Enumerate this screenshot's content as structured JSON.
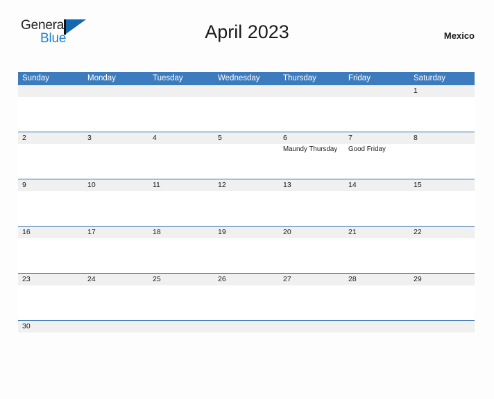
{
  "logo": {
    "word_one": "General",
    "word_two": "Blue",
    "flag_icon": "triangle-flag-icon",
    "primary_color": "#1268b3",
    "text_color": "#231f20"
  },
  "header": {
    "title": "April 2023",
    "region": "Mexico"
  },
  "calendar": {
    "header_bg": "#3c7cbe",
    "rule_color": "#2b6cab",
    "date_band_bg": "#f0f0f0",
    "weekdays": [
      "Sunday",
      "Monday",
      "Tuesday",
      "Wednesday",
      "Thursday",
      "Friday",
      "Saturday"
    ],
    "weeks": [
      {
        "days": [
          {
            "num": "",
            "event": ""
          },
          {
            "num": "",
            "event": ""
          },
          {
            "num": "",
            "event": ""
          },
          {
            "num": "",
            "event": ""
          },
          {
            "num": "",
            "event": ""
          },
          {
            "num": "",
            "event": ""
          },
          {
            "num": "1",
            "event": ""
          }
        ]
      },
      {
        "days": [
          {
            "num": "2",
            "event": ""
          },
          {
            "num": "3",
            "event": ""
          },
          {
            "num": "4",
            "event": ""
          },
          {
            "num": "5",
            "event": ""
          },
          {
            "num": "6",
            "event": "Maundy Thursday"
          },
          {
            "num": "7",
            "event": "Good Friday"
          },
          {
            "num": "8",
            "event": ""
          }
        ]
      },
      {
        "days": [
          {
            "num": "9",
            "event": ""
          },
          {
            "num": "10",
            "event": ""
          },
          {
            "num": "11",
            "event": ""
          },
          {
            "num": "12",
            "event": ""
          },
          {
            "num": "13",
            "event": ""
          },
          {
            "num": "14",
            "event": ""
          },
          {
            "num": "15",
            "event": ""
          }
        ]
      },
      {
        "days": [
          {
            "num": "16",
            "event": ""
          },
          {
            "num": "17",
            "event": ""
          },
          {
            "num": "18",
            "event": ""
          },
          {
            "num": "19",
            "event": ""
          },
          {
            "num": "20",
            "event": ""
          },
          {
            "num": "21",
            "event": ""
          },
          {
            "num": "22",
            "event": ""
          }
        ]
      },
      {
        "days": [
          {
            "num": "23",
            "event": ""
          },
          {
            "num": "24",
            "event": ""
          },
          {
            "num": "25",
            "event": ""
          },
          {
            "num": "26",
            "event": ""
          },
          {
            "num": "27",
            "event": ""
          },
          {
            "num": "28",
            "event": ""
          },
          {
            "num": "29",
            "event": ""
          }
        ]
      },
      {
        "last": true,
        "days": [
          {
            "num": "30",
            "event": ""
          },
          {
            "num": "",
            "event": ""
          },
          {
            "num": "",
            "event": ""
          },
          {
            "num": "",
            "event": ""
          },
          {
            "num": "",
            "event": ""
          },
          {
            "num": "",
            "event": ""
          },
          {
            "num": "",
            "event": ""
          }
        ]
      }
    ]
  }
}
